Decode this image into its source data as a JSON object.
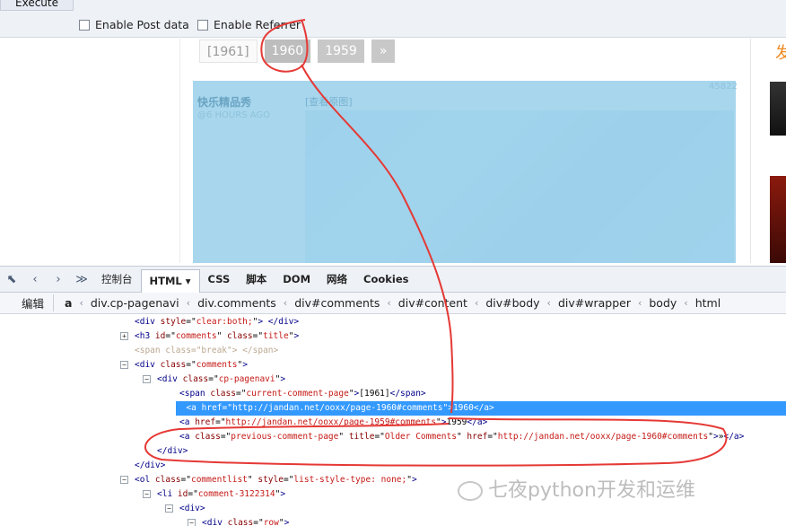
{
  "hackbar": {
    "execute_label": "Execute",
    "enable_post_label": "Enable Post data",
    "enable_referrer_label": "Enable Referrer"
  },
  "page": {
    "pagination": {
      "current": "[1961]",
      "prev_1": "1960",
      "prev_2": "1959",
      "older": "»"
    },
    "post": {
      "author": "快乐精品秀",
      "time": "@6 HOURS AGO",
      "view_link": "[查看原图]",
      "id": "45822"
    },
    "sidebar_logo": "发"
  },
  "devtools": {
    "tabs": [
      {
        "label": "控制台"
      },
      {
        "label": "HTML",
        "active": true
      },
      {
        "label": "CSS"
      },
      {
        "label": "脚本"
      },
      {
        "label": "DOM"
      },
      {
        "label": "网络"
      },
      {
        "label": "Cookies"
      }
    ],
    "edit_label": "编辑",
    "breadcrumb": [
      "a",
      "div.cp-pagenavi",
      "div.comments",
      "div#comments",
      "div#content",
      "div#body",
      "div#wrapper",
      "body",
      "html"
    ]
  },
  "tree": {
    "l1": {
      "tag": "div",
      "attr": "style",
      "val": "clear:both;"
    },
    "l2": {
      "tag": "h3",
      "a1": "id",
      "v1": "comments",
      "a2": "class",
      "v2": "title"
    },
    "l3": {
      "tag": "span",
      "attr": "class",
      "val": "break"
    },
    "l4": {
      "tag": "div",
      "attr": "class",
      "val": "comments"
    },
    "l5": {
      "tag": "div",
      "attr": "class",
      "val": "cp-pagenavi"
    },
    "l6": {
      "tag": "span",
      "attr": "class",
      "val": "current-comment-page",
      "text": "[1961]"
    },
    "l7": {
      "tag": "a",
      "attr": "href",
      "val": "http://jandan.net/ooxx/page-1960#comments",
      "text": "1960"
    },
    "l8": {
      "tag": "a",
      "attr": "href",
      "val": "http://jandan.net/ooxx/page-1959#comments",
      "text": "1959"
    },
    "l9": {
      "tag": "a",
      "a1": "class",
      "v1": "previous-comment-page",
      "a2": "title",
      "v2": "Older Comments",
      "a3": "href",
      "v3": "http://jandan.net/ooxx/page-1960#comments",
      "text": "»"
    },
    "l10": {
      "tag": "div"
    },
    "l11": {
      "tag": "div"
    },
    "l12": {
      "tag": "ol",
      "a1": "class",
      "v1": "commentlist",
      "a2": "style",
      "v2": "list-style-type: none;"
    },
    "l13": {
      "tag": "li",
      "attr": "id",
      "val": "comment-3122314"
    },
    "l14": {
      "tag": "div"
    },
    "l15": {
      "tag": "div",
      "attr": "class",
      "val": "row"
    }
  },
  "watermark": "七夜python开发和运维",
  "colors": {
    "selection": "#3399ff",
    "highlight_overlay": "#9fd3ec",
    "annotation": "#e53935"
  }
}
